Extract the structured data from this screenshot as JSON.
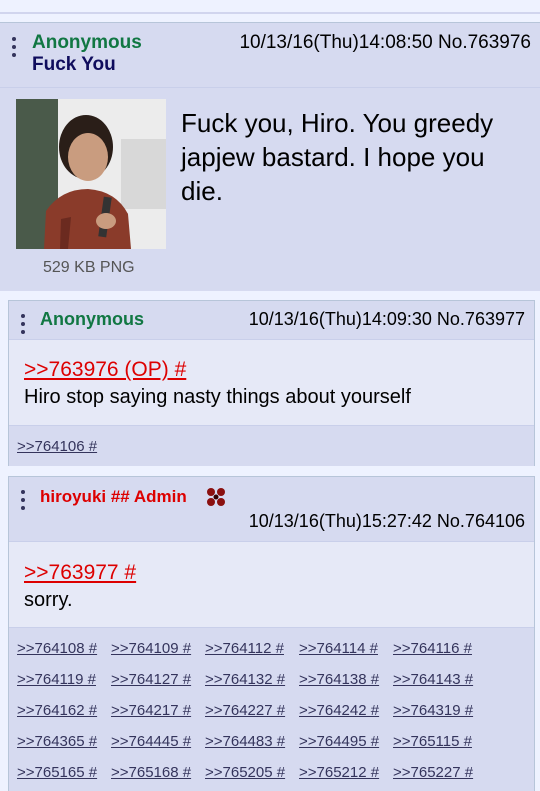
{
  "op": {
    "name": "Anonymous",
    "subject": "Fuck You",
    "datetime": "10/13/16(Thu)14:08:50",
    "number": "No.763976",
    "file_info": "529 KB PNG",
    "comment": "Fuck you, Hiro. You greedy japjew bastard. I hope you die."
  },
  "reply1": {
    "name": "Anonymous",
    "datetime": "10/13/16(Thu)14:09:30",
    "number": "No.763977",
    "quote": ">>763976 (OP) #",
    "comment": "Hiro stop saying nasty things about yourself",
    "backlinks": [
      ">>764106 #"
    ]
  },
  "reply2": {
    "name": "hiroyuki ## Admin",
    "datetime": "10/13/16(Thu)15:27:42",
    "number": "No.764106",
    "quote": ">>763977 #",
    "comment": "sorry.",
    "backlinks": [
      ">>764108 #",
      ">>764109 #",
      ">>764112 #",
      ">>764114 #",
      ">>764116 #",
      ">>764119 #",
      ">>764127 #",
      ">>764132 #",
      ">>764138 #",
      ">>764143 #",
      ">>764162 #",
      ">>764217 #",
      ">>764227 #",
      ">>764242 #",
      ">>764319 #",
      ">>764365 #",
      ">>764445 #",
      ">>764483 #",
      ">>764495 #",
      ">>765115 #",
      ">>765165 #",
      ">>765168 #",
      ">>765205 #",
      ">>765212 #",
      ">>765227 #"
    ]
  },
  "colors": {
    "post_bg": "#d6daf0",
    "name_green": "#117743",
    "subject_blue": "#0f0c5d",
    "quote_red": "#dd0000",
    "link": "#34345c"
  },
  "icons": {
    "menu": "vertical-dots-icon",
    "admin": "admin-emblem-icon"
  }
}
